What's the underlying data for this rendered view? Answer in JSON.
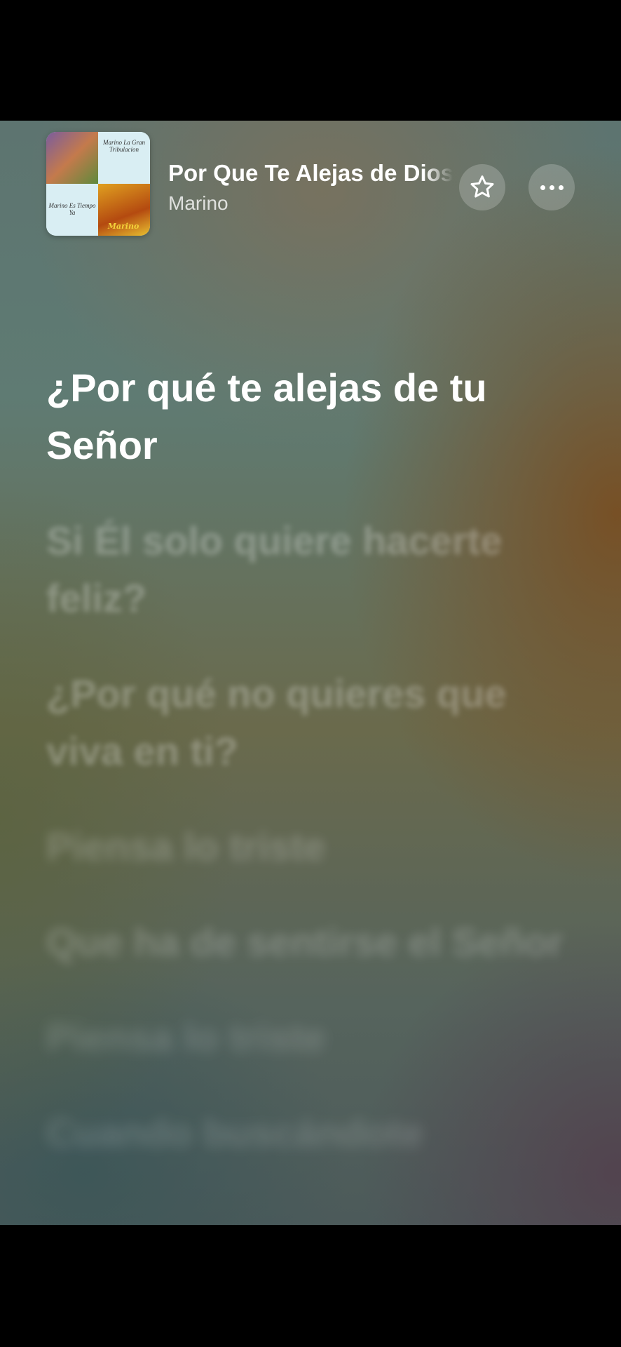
{
  "now_playing": {
    "title": "Por Que Te Alejas de Dios",
    "artist": "Marino",
    "album_art_text": {
      "top_right": "Marino La Gran Tribulacion",
      "bottom_left": "Marino Es Tiempo Ya",
      "bottom_right_logo": "Marino"
    }
  },
  "icons": {
    "favorite": "star-outline-icon",
    "more": "ellipsis-icon"
  },
  "lyrics": [
    "¿Por qué te alejas de tu Señor",
    "Si Él solo quiere hacerte feliz?",
    "¿Por qué no quieres que viva en ti?",
    "Piensa lo triste",
    "Que ha de sentirse el Señor",
    "Piensa lo triste",
    "Cuando buscándote"
  ]
}
